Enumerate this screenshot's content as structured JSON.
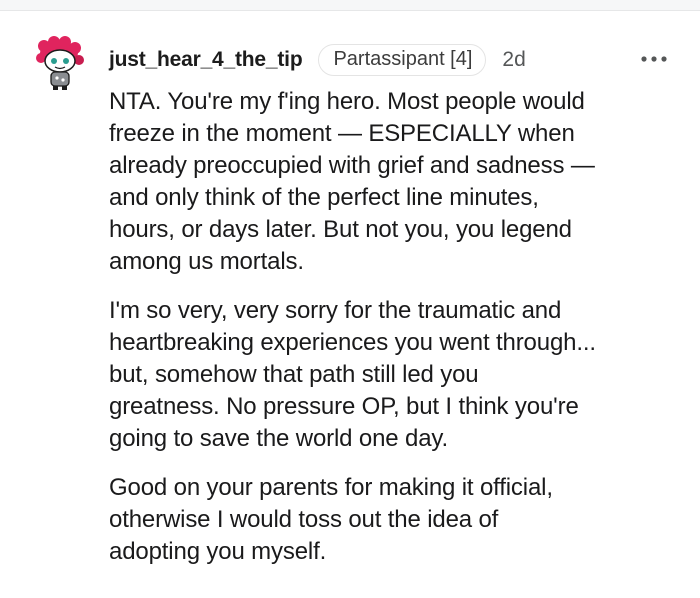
{
  "comment": {
    "username": "just_hear_4_the_tip",
    "flair": "Partassipant [4]",
    "timestamp": "2d",
    "avatar_icon": "reddit-snoo-avatar-icon",
    "more_icon": "more-options-icon",
    "paragraphs": [
      "NTA. You're my f'ing hero. Most people would\nfreeze in the moment — ESPECIALLY when\nalready preoccupied with grief and sadness —\nand only think of the perfect line minutes,\nhours, or days later. But not you, you legend\namong us mortals.",
      "I'm so very, very sorry for the traumatic and\nheartbreaking experiences you went through...\nbut, somehow that path still led you\ngreatness. No pressure OP, but I think you're\ngoing to save the world one day.",
      "Good on your parents for making it official,\notherwise I would toss out the idea of\nadopting you myself."
    ]
  },
  "colors": {
    "text": "#1a1a1b",
    "meta": "#555758",
    "avatar_hair": "#e0245e",
    "flair_border": "#e4e4e4"
  }
}
